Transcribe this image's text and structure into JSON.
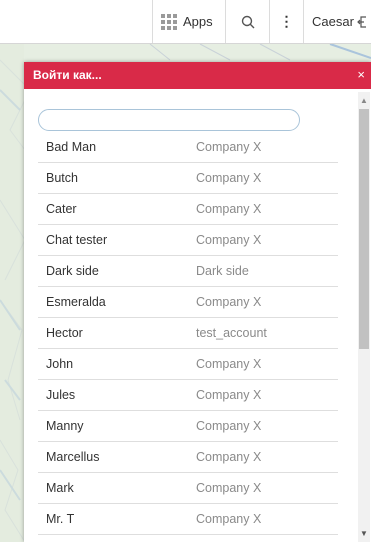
{
  "topbar": {
    "apps_label": "Apps",
    "search_icon": "magnifier",
    "more_icon": "vertical-ellipsis",
    "more_glyph": "⋮",
    "user_label": "Caesar",
    "exit_icon": "logout"
  },
  "dialog": {
    "title": "Войти как...",
    "close_glyph": "×",
    "search_placeholder": "",
    "accent_color": "#d92a48",
    "users": [
      {
        "name": "Bad Man",
        "company": "Company X"
      },
      {
        "name": "Butch",
        "company": "Company X"
      },
      {
        "name": "Cater",
        "company": "Company X"
      },
      {
        "name": "Chat tester",
        "company": "Company X"
      },
      {
        "name": "Dark side",
        "company": "Dark side"
      },
      {
        "name": "Esmeralda",
        "company": "Company X"
      },
      {
        "name": "Hector",
        "company": "test_account"
      },
      {
        "name": "John",
        "company": "Company X"
      },
      {
        "name": "Jules",
        "company": "Company X"
      },
      {
        "name": "Manny",
        "company": "Company X"
      },
      {
        "name": "Marcellus",
        "company": "Company X"
      },
      {
        "name": "Mark",
        "company": "Company X"
      },
      {
        "name": "Mr. T",
        "company": "Company X"
      }
    ]
  }
}
